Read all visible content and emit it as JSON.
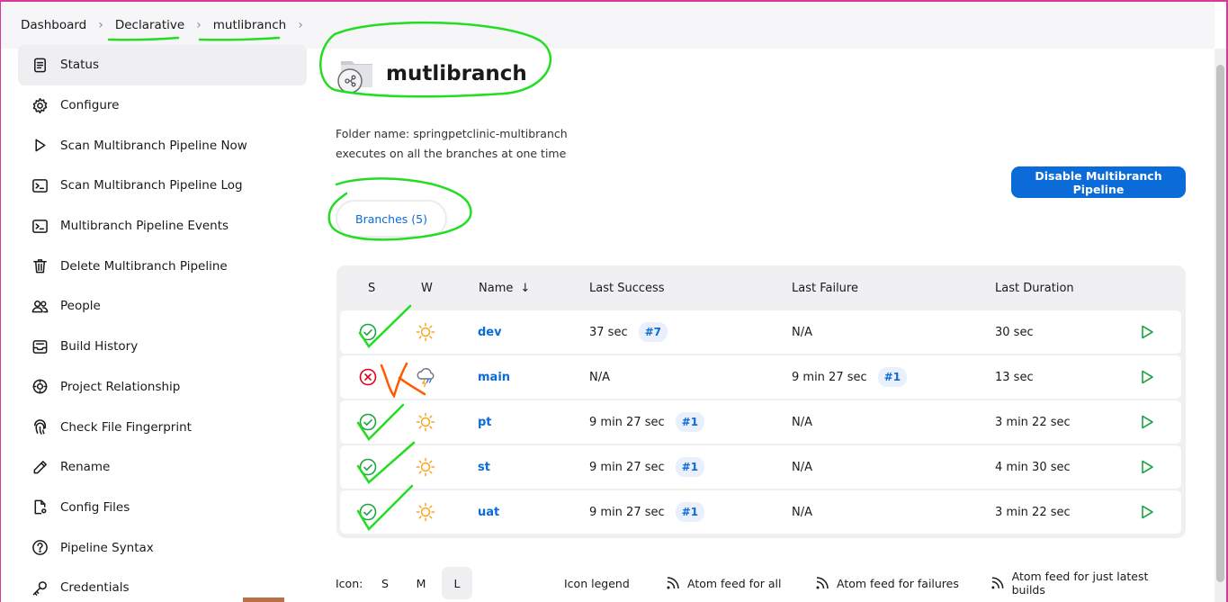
{
  "breadcrumb": {
    "items": [
      "Dashboard",
      "Declarative",
      "mutlibranch"
    ],
    "separator": ">"
  },
  "sidebar": {
    "items": [
      {
        "label": "Status",
        "icon": "document-icon",
        "active": true
      },
      {
        "label": "Configure",
        "icon": "gear-icon"
      },
      {
        "label": "Scan Multibranch Pipeline Now",
        "icon": "play-icon"
      },
      {
        "label": "Scan Multibranch Pipeline Log",
        "icon": "terminal-icon"
      },
      {
        "label": "Multibranch Pipeline Events",
        "icon": "terminal-icon"
      },
      {
        "label": "Delete Multibranch Pipeline",
        "icon": "trash-icon"
      },
      {
        "label": "People",
        "icon": "people-icon"
      },
      {
        "label": "Build History",
        "icon": "inbox-icon"
      },
      {
        "label": "Project Relationship",
        "icon": "relationship-icon"
      },
      {
        "label": "Check File Fingerprint",
        "icon": "fingerprint-icon"
      },
      {
        "label": "Rename",
        "icon": "pencil-icon"
      },
      {
        "label": "Config Files",
        "icon": "file-gear-icon"
      },
      {
        "label": "Pipeline Syntax",
        "icon": "help-icon"
      },
      {
        "label": "Credentials",
        "icon": "key-icon"
      }
    ]
  },
  "page": {
    "title": "mutlibranch",
    "folder_name_line": "Folder name: springpetclinic-multibranch",
    "description": "executes on all the branches at one time",
    "disable_button": "Disable Multibranch Pipeline",
    "tab_label": "Branches (5)"
  },
  "table": {
    "headers": {
      "s": "S",
      "w": "W",
      "name": "Name",
      "name_sort": "↓",
      "last_success": "Last Success",
      "last_failure": "Last Failure",
      "last_duration": "Last Duration"
    },
    "rows": [
      {
        "status": "success",
        "weather": "sunny",
        "name": "dev",
        "last_success": "37 sec",
        "last_success_build": "#7",
        "last_failure": "N/A",
        "last_failure_build": "",
        "duration": "30 sec"
      },
      {
        "status": "failed",
        "weather": "storm",
        "name": "main",
        "last_success": "N/A",
        "last_success_build": "",
        "last_failure": "9 min 27 sec",
        "last_failure_build": "#1",
        "duration": "13 sec"
      },
      {
        "status": "success",
        "weather": "sunny",
        "name": "pt",
        "last_success": "9 min 27 sec",
        "last_success_build": "#1",
        "last_failure": "N/A",
        "last_failure_build": "",
        "duration": "3 min 22 sec"
      },
      {
        "status": "success",
        "weather": "sunny",
        "name": "st",
        "last_success": "9 min 27 sec",
        "last_success_build": "#1",
        "last_failure": "N/A",
        "last_failure_build": "",
        "duration": "4 min 30 sec"
      },
      {
        "status": "success",
        "weather": "sunny",
        "name": "uat",
        "last_success": "9 min 27 sec",
        "last_success_build": "#1",
        "last_failure": "N/A",
        "last_failure_build": "",
        "duration": "3 min 22 sec"
      }
    ]
  },
  "footer": {
    "icon_label": "Icon:",
    "sizes": [
      "S",
      "M",
      "L"
    ],
    "selected_size": "L",
    "legend": "Icon legend",
    "feed_all": "Atom feed for all",
    "feed_failures": "Atom feed for failures",
    "feed_latest": "Atom feed for just latest builds"
  },
  "colors": {
    "accent": "#0b6bd9",
    "success": "#1ea446",
    "failure": "#e6001f",
    "annotation_green": "#22dd22",
    "annotation_orange": "#ff5a00",
    "sun": "#f5a623"
  }
}
